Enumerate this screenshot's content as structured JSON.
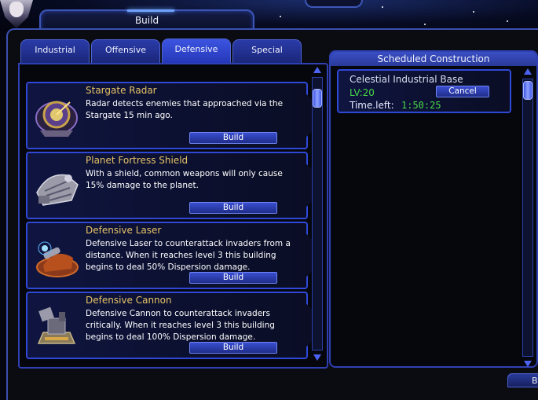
{
  "window": {
    "title": "Build"
  },
  "tabs": [
    {
      "label": "Industrial",
      "active": false
    },
    {
      "label": "Offensive",
      "active": false
    },
    {
      "label": "Defensive",
      "active": true
    },
    {
      "label": "Special",
      "active": false
    }
  ],
  "buildings": [
    {
      "name": "Stargate Radar",
      "description": "Radar detects enemies that approached via the  Stargate 15 min ago.",
      "build_label": "Build",
      "icon": "radar-icon"
    },
    {
      "name": "Planet Fortress Shield",
      "description": "With a shield, common weapons will only cause 15% damage to the planet.",
      "build_label": "Build",
      "icon": "shield-generator-icon"
    },
    {
      "name": "Defensive Laser",
      "description": "Defensive Laser to counterattack invaders from a distance. When it reaches level 3 this building begins to deal 50% Dispersion damage.",
      "build_label": "Build",
      "icon": "laser-turret-icon"
    },
    {
      "name": "Defensive Cannon",
      "description": "Defensive Cannon to counterattack invaders  critically. When it reaches level 3 this building begins to deal 100% Dispersion damage.",
      "build_label": "Build",
      "icon": "cannon-turret-icon"
    }
  ],
  "scheduled": {
    "title": "Scheduled Construction",
    "items": [
      {
        "name": "Celestial Industrial Base",
        "level": "LV:20",
        "cancel_label": "Cancel",
        "time_label": "Time.left:",
        "time_left": "1:50:25"
      }
    ]
  },
  "bottom_button": {
    "label": "B"
  },
  "colors": {
    "accent": "#2f48d8",
    "name_text": "#e8c466",
    "timer": "#48d848",
    "tab_active": "#3b54e0"
  }
}
